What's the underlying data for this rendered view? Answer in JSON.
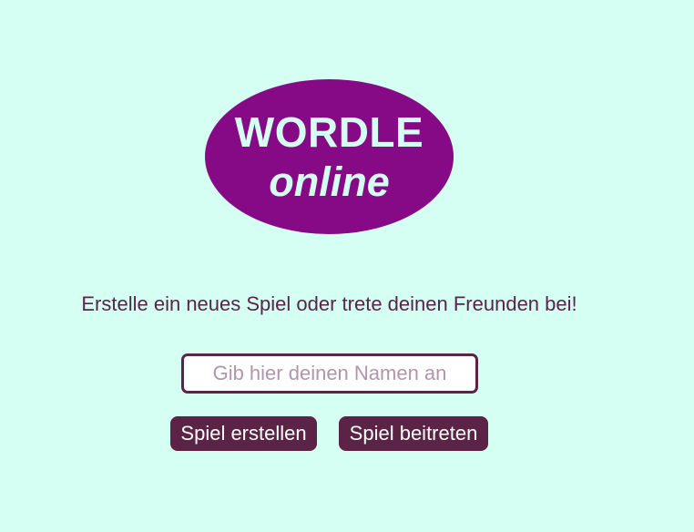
{
  "logo": {
    "title": "WORDLE",
    "subtitle": "online"
  },
  "tagline": "Erstelle ein neues Spiel oder trete deinen Freunden bei!",
  "name_input": {
    "value": "",
    "placeholder": "Gib hier deinen Namen an"
  },
  "buttons": {
    "create": "Spiel erstellen",
    "join": "Spiel beitreten"
  },
  "colors": {
    "background": "#d5fff2",
    "logo_background": "#860a86",
    "logo_text": "#d5fff2",
    "primary": "#5b2446",
    "placeholder": "#b096ab"
  }
}
